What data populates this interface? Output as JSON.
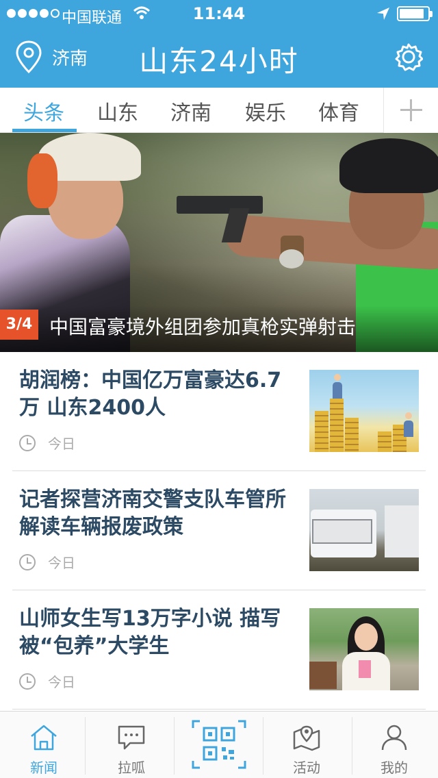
{
  "status_bar": {
    "carrier": "中国联通",
    "time": "11:44"
  },
  "header": {
    "city": "济南",
    "title": "山东24小时"
  },
  "tabs": [
    {
      "label": "头条",
      "active": true
    },
    {
      "label": "山东",
      "active": false
    },
    {
      "label": "济南",
      "active": false
    },
    {
      "label": "娱乐",
      "active": false
    },
    {
      "label": "体育",
      "active": false
    }
  ],
  "hero": {
    "counter": "3/4",
    "title": "中国富豪境外组团参加真枪实弹射击"
  },
  "news": [
    {
      "title": "胡润榜：中国亿万富豪达6.7万 山东2400人",
      "time": "今日"
    },
    {
      "title": "记者探营济南交警支队车管所 解读车辆报废政策",
      "time": "今日"
    },
    {
      "title": "山师女生写13万字小说 描写被“包养”大学生",
      "time": "今日"
    }
  ],
  "bottom_nav": [
    {
      "label": "新闻",
      "icon": "home-icon",
      "active": true
    },
    {
      "label": "拉呱",
      "icon": "chat-icon",
      "active": false
    },
    {
      "label": "",
      "icon": "qr-scan-icon",
      "active": false
    },
    {
      "label": "活动",
      "icon": "map-pin-icon",
      "active": false
    },
    {
      "label": "我的",
      "icon": "user-icon",
      "active": false
    }
  ],
  "colors": {
    "accent": "#3fa6dd",
    "news_title": "#2c4a63",
    "badge": "#e6532b"
  }
}
